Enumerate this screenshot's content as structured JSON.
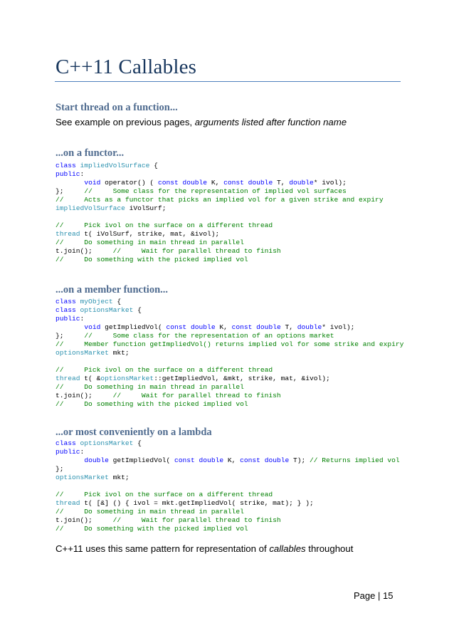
{
  "document": {
    "title": "C++11 Callables",
    "sections": [
      {
        "heading": "Start thread on a function...",
        "text_plain": "See example on previous pages, ",
        "text_italic": "arguments listed after function name"
      },
      {
        "heading": "...on a functor...",
        "code": [
          [
            {
              "t": "class ",
              "c": "kw"
            },
            {
              "t": "impliedVolSurface",
              "c": "ty"
            },
            {
              "t": " {",
              "c": "pt"
            }
          ],
          [
            {
              "t": "public",
              "c": "kw"
            },
            {
              "t": ":",
              "c": "pt"
            }
          ],
          [
            {
              "t": "       ",
              "c": "pt"
            },
            {
              "t": "void",
              "c": "kw"
            },
            {
              "t": " operator() ( ",
              "c": "pt"
            },
            {
              "t": "const",
              "c": "kw"
            },
            {
              "t": " ",
              "c": "pt"
            },
            {
              "t": "double",
              "c": "kw"
            },
            {
              "t": " K, ",
              "c": "pt"
            },
            {
              "t": "const",
              "c": "kw"
            },
            {
              "t": " ",
              "c": "pt"
            },
            {
              "t": "double",
              "c": "kw"
            },
            {
              "t": " T, ",
              "c": "pt"
            },
            {
              "t": "double",
              "c": "kw"
            },
            {
              "t": "* ivol);",
              "c": "pt"
            }
          ],
          [
            {
              "t": "};     ",
              "c": "pt"
            },
            {
              "t": "//     Some class for the representation of implied vol surfaces",
              "c": "cm"
            }
          ],
          [
            {
              "t": "//     Acts as a functor that picks an implied vol for a given strike and expiry",
              "c": "cm"
            }
          ],
          [
            {
              "t": "impliedVolSurface",
              "c": "ty"
            },
            {
              "t": " iVolSurf;",
              "c": "pt"
            }
          ],
          [],
          [
            {
              "t": "//     Pick ivol on the surface on a different thread",
              "c": "cm"
            }
          ],
          [
            {
              "t": "thread",
              "c": "ty"
            },
            {
              "t": " t( iVolSurf, strike, mat, &ivol);",
              "c": "pt"
            }
          ],
          [
            {
              "t": "//     Do something in main thread in parallel",
              "c": "cm"
            }
          ],
          [
            {
              "t": "t.join();     ",
              "c": "pt"
            },
            {
              "t": "//     Wait for parallel thread to finish",
              "c": "cm"
            }
          ],
          [
            {
              "t": "//     Do something with the picked implied vol",
              "c": "cm"
            }
          ]
        ]
      },
      {
        "heading": "...on a member function...",
        "code": [
          [
            {
              "t": "class ",
              "c": "kw"
            },
            {
              "t": "myObject",
              "c": "ty"
            },
            {
              "t": " {",
              "c": "pt"
            }
          ],
          [
            {
              "t": "class ",
              "c": "kw"
            },
            {
              "t": "optionsMarket",
              "c": "ty"
            },
            {
              "t": " {",
              "c": "pt"
            }
          ],
          [
            {
              "t": "public",
              "c": "kw"
            },
            {
              "t": ":",
              "c": "pt"
            }
          ],
          [
            {
              "t": "       ",
              "c": "pt"
            },
            {
              "t": "void",
              "c": "kw"
            },
            {
              "t": " getImpliedVol( ",
              "c": "pt"
            },
            {
              "t": "const",
              "c": "kw"
            },
            {
              "t": " ",
              "c": "pt"
            },
            {
              "t": "double",
              "c": "kw"
            },
            {
              "t": " K, ",
              "c": "pt"
            },
            {
              "t": "const",
              "c": "kw"
            },
            {
              "t": " ",
              "c": "pt"
            },
            {
              "t": "double",
              "c": "kw"
            },
            {
              "t": " T, ",
              "c": "pt"
            },
            {
              "t": "double",
              "c": "kw"
            },
            {
              "t": "* ivol);",
              "c": "pt"
            }
          ],
          [
            {
              "t": "};     ",
              "c": "pt"
            },
            {
              "t": "//     Some class for the representation of an options market",
              "c": "cm"
            }
          ],
          [
            {
              "t": "//     Member function getImpliedVol() returns implied vol for some strike and expiry",
              "c": "cm"
            }
          ],
          [
            {
              "t": "optionsMarket",
              "c": "ty"
            },
            {
              "t": " mkt;",
              "c": "pt"
            }
          ],
          [],
          [
            {
              "t": "//     Pick ivol on the surface on a different thread",
              "c": "cm"
            }
          ],
          [
            {
              "t": "thread",
              "c": "ty"
            },
            {
              "t": " t( &",
              "c": "pt"
            },
            {
              "t": "optionsMarket",
              "c": "ty"
            },
            {
              "t": "::getImpliedVol, &mkt, strike, mat, &ivol);",
              "c": "pt"
            }
          ],
          [
            {
              "t": "//     Do something in main thread in parallel",
              "c": "cm"
            }
          ],
          [
            {
              "t": "t.join();     ",
              "c": "pt"
            },
            {
              "t": "//     Wait for parallel thread to finish",
              "c": "cm"
            }
          ],
          [
            {
              "t": "//     Do something with the picked implied vol",
              "c": "cm"
            }
          ]
        ]
      },
      {
        "heading": "...or most conveniently on a lambda",
        "code": [
          [
            {
              "t": "class ",
              "c": "kw"
            },
            {
              "t": "optionsMarket",
              "c": "ty"
            },
            {
              "t": " {",
              "c": "pt"
            }
          ],
          [
            {
              "t": "public",
              "c": "kw"
            },
            {
              "t": ":",
              "c": "pt"
            }
          ],
          [
            {
              "t": "       ",
              "c": "pt"
            },
            {
              "t": "double",
              "c": "kw"
            },
            {
              "t": " getImpliedVol( ",
              "c": "pt"
            },
            {
              "t": "const",
              "c": "kw"
            },
            {
              "t": " ",
              "c": "pt"
            },
            {
              "t": "double",
              "c": "kw"
            },
            {
              "t": " K, ",
              "c": "pt"
            },
            {
              "t": "const",
              "c": "kw"
            },
            {
              "t": " ",
              "c": "pt"
            },
            {
              "t": "double",
              "c": "kw"
            },
            {
              "t": " T); ",
              "c": "pt"
            },
            {
              "t": "// Returns implied vol",
              "c": "cm"
            }
          ],
          [
            {
              "t": "};",
              "c": "pt"
            }
          ],
          [
            {
              "t": "optionsMarket",
              "c": "ty"
            },
            {
              "t": " mkt;",
              "c": "pt"
            }
          ],
          [],
          [
            {
              "t": "//     Pick ivol on the surface on a different thread",
              "c": "cm"
            }
          ],
          [
            {
              "t": "thread",
              "c": "ty"
            },
            {
              "t": " t( [&] () { ivol = mkt.getImpliedVol( strike, mat); } );",
              "c": "pt"
            }
          ],
          [
            {
              "t": "//     Do something in main thread in parallel",
              "c": "cm"
            }
          ],
          [
            {
              "t": "t.join();     ",
              "c": "pt"
            },
            {
              "t": "//     Wait for parallel thread to finish",
              "c": "cm"
            }
          ],
          [
            {
              "t": "//     Do something with the picked implied vol",
              "c": "cm"
            }
          ]
        ]
      }
    ],
    "closing": {
      "plain_before": "C++11 uses this same pattern for representation of ",
      "italic": "callables",
      "plain_after": " throughout"
    },
    "footer": {
      "page_label": "Page | 15"
    }
  }
}
